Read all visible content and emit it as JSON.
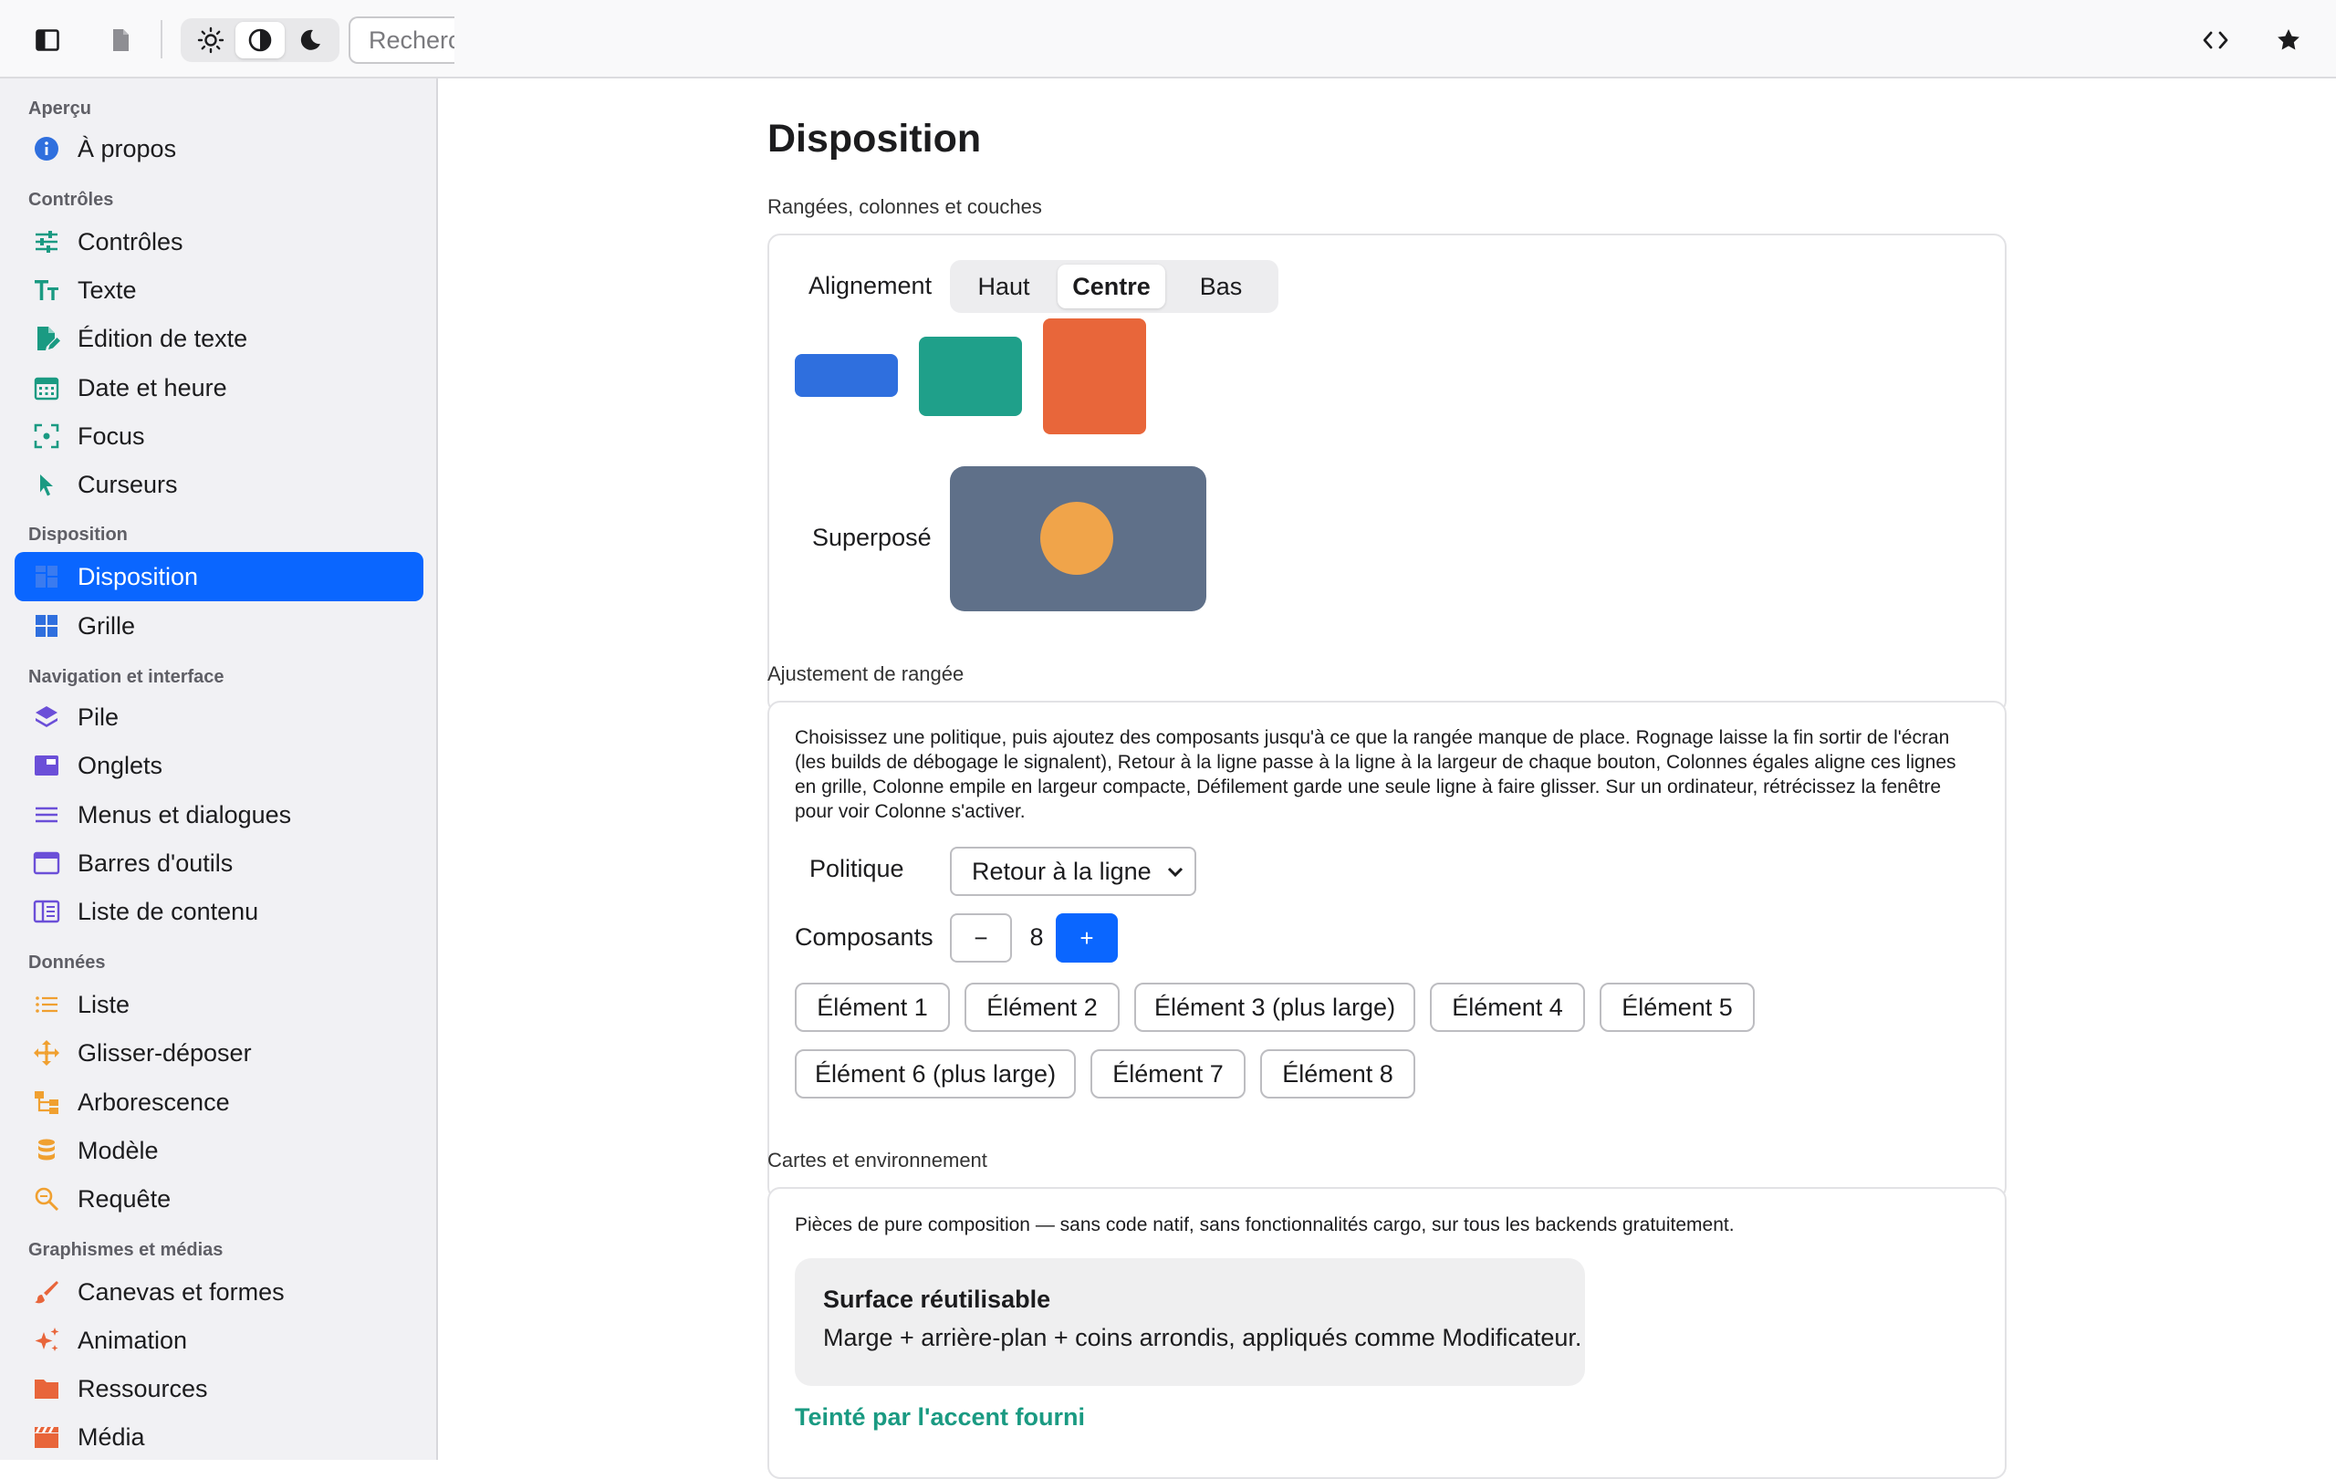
{
  "toolbar": {
    "search_placeholder": "Recherc",
    "theme_options": [
      "light",
      "auto",
      "dark"
    ],
    "active_theme": "auto"
  },
  "sidebar": {
    "sections": [
      {
        "title": "Aperçu",
        "items": [
          {
            "label": "À propos",
            "icon": "info-icon",
            "color": "#2f6fde"
          }
        ]
      },
      {
        "title": "Contrôles",
        "items": [
          {
            "label": "Contrôles",
            "icon": "sliders-icon",
            "color": "#1a9a82"
          },
          {
            "label": "Texte",
            "icon": "text-size-icon",
            "color": "#1a9a82"
          },
          {
            "label": "Édition de texte",
            "icon": "edit-document-icon",
            "color": "#1a9a82"
          },
          {
            "label": "Date et heure",
            "icon": "calendar-icon",
            "color": "#1a9a82"
          },
          {
            "label": "Focus",
            "icon": "focus-icon",
            "color": "#1a9a82"
          },
          {
            "label": "Curseurs",
            "icon": "cursor-icon",
            "color": "#1a9a82"
          }
        ]
      },
      {
        "title": "Disposition",
        "items": [
          {
            "label": "Disposition",
            "icon": "layout-icon",
            "color": "#2f6fde",
            "active": true
          },
          {
            "label": "Grille",
            "icon": "grid-icon",
            "color": "#2f6fde"
          }
        ]
      },
      {
        "title": "Navigation et interface",
        "items": [
          {
            "label": "Pile",
            "icon": "layers-icon",
            "color": "#6b4fd8"
          },
          {
            "label": "Onglets",
            "icon": "tabs-icon",
            "color": "#6b4fd8"
          },
          {
            "label": "Menus et dialogues",
            "icon": "menu-icon",
            "color": "#6b4fd8"
          },
          {
            "label": "Barres d'outils",
            "icon": "toolbar-icon",
            "color": "#6b4fd8"
          },
          {
            "label": "Liste de contenu",
            "icon": "content-list-icon",
            "color": "#6b4fd8"
          }
        ]
      },
      {
        "title": "Données",
        "items": [
          {
            "label": "Liste",
            "icon": "list-icon",
            "color": "#f0a030"
          },
          {
            "label": "Glisser-déposer",
            "icon": "move-icon",
            "color": "#f0a030"
          },
          {
            "label": "Arborescence",
            "icon": "tree-icon",
            "color": "#f0a030"
          },
          {
            "label": "Modèle",
            "icon": "database-icon",
            "color": "#f0a030"
          },
          {
            "label": "Requête",
            "icon": "search-icon",
            "color": "#f0a030"
          }
        ]
      },
      {
        "title": "Graphismes et médias",
        "items": [
          {
            "label": "Canevas et formes",
            "icon": "brush-icon",
            "color": "#e8653a"
          },
          {
            "label": "Animation",
            "icon": "sparkle-icon",
            "color": "#e8653a"
          },
          {
            "label": "Ressources",
            "icon": "folder-icon",
            "color": "#e8653a"
          },
          {
            "label": "Média",
            "icon": "clapper-icon",
            "color": "#e8653a"
          }
        ]
      }
    ]
  },
  "main": {
    "title": "Disposition",
    "rows_section": {
      "label": "Rangées, colonnes et couches",
      "alignment_label": "Alignement",
      "alignment_options": [
        "Haut",
        "Centre",
        "Bas"
      ],
      "alignment_selected": "Centre",
      "block_colors": [
        "#2f6fde",
        "#1fa08a",
        "#e8663a"
      ],
      "stack_label": "Superposé",
      "stack_colors": {
        "box": "#5f7089",
        "dot": "#f0a44a"
      }
    },
    "fit_section": {
      "label": "Ajustement de rangée",
      "description": "Choisissez une politique, puis ajoutez des composants jusqu'à ce que la rangée manque de place. Rognage laisse la fin sortir de l'écran (les builds de débogage le signalent), Retour à la ligne passe à la ligne à la largeur de chaque bouton, Colonnes égales aligne ces lignes en grille, Colonne empile en largeur compacte, Défilement garde une seule ligne à faire glisser. Sur un ordinateur, rétrécissez la fenêtre pour voir Colonne s'activer.",
      "policy_label": "Politique",
      "policy_value": "Retour à la ligne",
      "components_label": "Composants",
      "minus_label": "−",
      "plus_label": "+",
      "count": "8",
      "items": [
        "Élément 1",
        "Élément 2",
        "Élément 3 (plus large)",
        "Élément 4",
        "Élément 5",
        "Élément 6 (plus large)",
        "Élément 7",
        "Élément 8"
      ]
    },
    "cards_section": {
      "label": "Cartes et environnement",
      "description": "Pièces de pure composition — sans code natif, sans fonctionnalités cargo, sur tous les backends gratuitement.",
      "surface_title": "Surface réutilisable",
      "surface_body": "Marge + arrière-plan + coins arrondis, appliqués comme Modificateur.",
      "accent_text": "Teinté par l'accent fourni",
      "accent_color": "#1a9a82"
    }
  }
}
